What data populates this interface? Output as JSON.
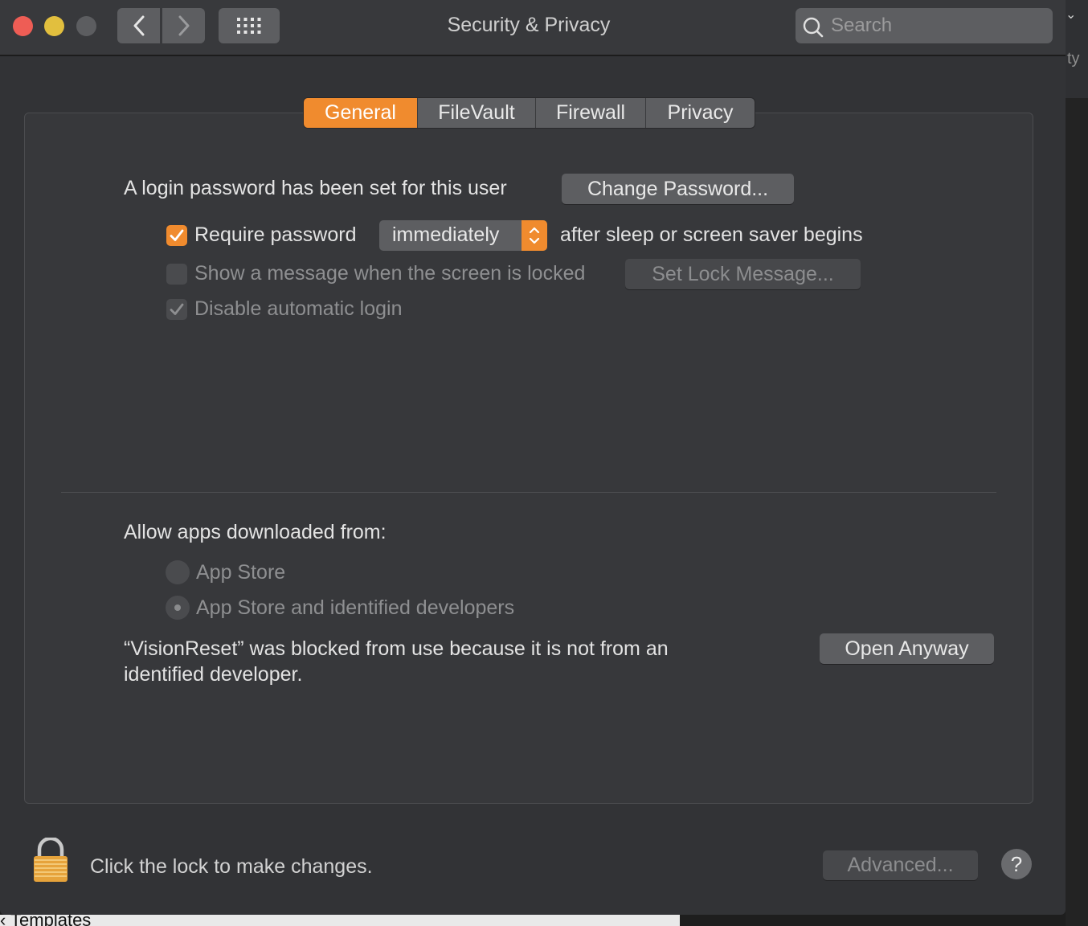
{
  "window": {
    "title": "Security & Privacy",
    "search_placeholder": "Search"
  },
  "background": {
    "edge_text": "ty",
    "bottom_text": "‹ Templates"
  },
  "tabs": [
    {
      "label": "General",
      "active": true
    },
    {
      "label": "FileVault",
      "active": false
    },
    {
      "label": "Firewall",
      "active": false
    },
    {
      "label": "Privacy",
      "active": false
    }
  ],
  "general": {
    "login_password_text": "A login password has been set for this user",
    "change_password_label": "Change Password...",
    "require_password": {
      "label": "Require password",
      "checked": true
    },
    "require_password_delay": "immediately",
    "require_password_suffix": "after sleep or screen saver begins",
    "show_message": {
      "label": "Show a message when the screen is locked",
      "checked": false,
      "enabled": false
    },
    "set_lock_message_label": "Set Lock Message...",
    "disable_auto_login": {
      "label": "Disable automatic login",
      "checked": true,
      "enabled": false
    }
  },
  "downloads": {
    "heading": "Allow apps downloaded from:",
    "options": [
      {
        "label": "App Store",
        "selected": false
      },
      {
        "label": "App Store and identified developers",
        "selected": true
      }
    ],
    "blocked_message": "“VisionReset” was blocked from use because it is not from an identified developer.",
    "open_anyway_label": "Open Anyway"
  },
  "footer": {
    "lock_text": "Click the lock to make changes.",
    "advanced_label": "Advanced...",
    "help_label": "?"
  },
  "colors": {
    "accent": "#f08b2e",
    "window_bg": "#323336",
    "close": "#ee5d55",
    "minimize": "#e2bf3e"
  }
}
